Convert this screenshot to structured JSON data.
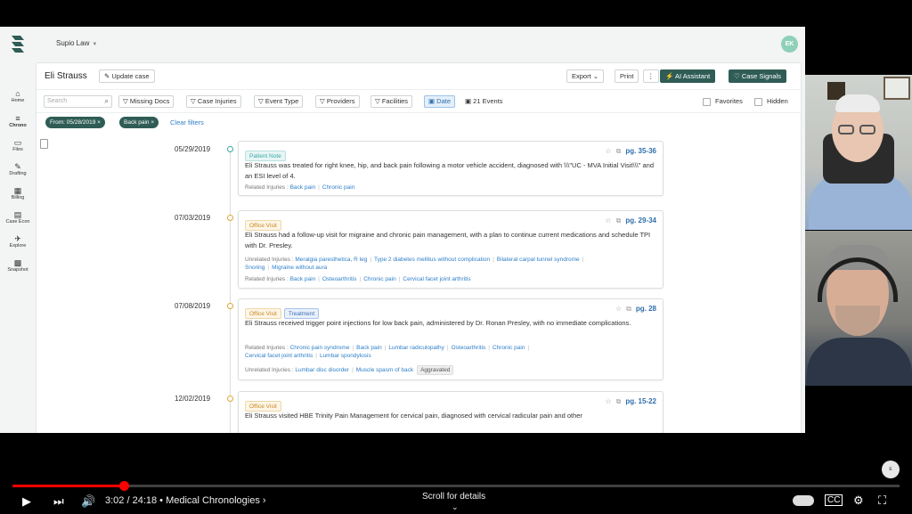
{
  "app": {
    "firm_name": "Supio Law",
    "avatar_initials": "EK",
    "rail": [
      {
        "icon": "home-icon",
        "glyph": "⌂",
        "label": "Home"
      },
      {
        "icon": "chrono-icon",
        "glyph": "≡",
        "label": "Chrono"
      },
      {
        "icon": "files-icon",
        "glyph": "▭",
        "label": "Files"
      },
      {
        "icon": "drafting-icon",
        "glyph": "✎",
        "label": "Drafting"
      },
      {
        "icon": "billing-icon",
        "glyph": "▦",
        "label": "Billing"
      },
      {
        "icon": "case-econ-icon",
        "glyph": "▤",
        "label": "Case Econ"
      },
      {
        "icon": "explore-icon",
        "glyph": "✈",
        "label": "Explore"
      },
      {
        "icon": "snapshot-icon",
        "glyph": "▩",
        "label": "Snapshot"
      }
    ]
  },
  "header": {
    "case_name": "Eli Strauss",
    "update_case": "Update case",
    "export": "Export",
    "print": "Print",
    "more": "⋮",
    "ai_assistant": "AI Assistant",
    "case_signals": "Case Signals"
  },
  "filters": {
    "search_placeholder": "Search",
    "missing_docs": "Missing Docs",
    "case_injuries": "Case Injuries",
    "event_type": "Event Type",
    "providers": "Providers",
    "facilities": "Facilities",
    "date": "Date",
    "events_count": "21 Events",
    "favorites": "Favorites",
    "hidden": "Hidden"
  },
  "chips": {
    "from": "From: 05/28/2019",
    "injury": "Back pain",
    "clear": "Clear filters"
  },
  "events": [
    {
      "date": "05/29/2019",
      "tags": [
        "Patient Note"
      ],
      "pages": "pg. 35-36",
      "description": "Eli Strauss was treated for right knee, hip, and back pain following a motor vehicle accident, diagnosed with \\\\\\\"UC - MVA Initial Visit\\\\\\\" and an ESI level of 4.",
      "related_label": "Related Injuries :",
      "related": [
        "Back pain",
        "Chronic pain"
      ]
    },
    {
      "date": "07/03/2019",
      "tags": [
        "Office Visit"
      ],
      "pages": "pg. 29-34",
      "description": "Eli Strauss had a follow-up visit for migraine and chronic pain management, with a plan to continue current medications and schedule TPI with Dr. Presley.",
      "unrelated_label": "Unrelated Injuries :",
      "unrelated": [
        "Meralgia paresthetica, R leg",
        "Type 2 diabetes mellitus without complication",
        "Bilateral carpal tunnel syndrome",
        "Snoring",
        "Migraine without aura"
      ],
      "related_label": "Related Injuries :",
      "related": [
        "Back pain",
        "Osteoarthritis",
        "Chronic pain",
        "Cervical facet joint arthritis"
      ]
    },
    {
      "date": "07/08/2019",
      "tags": [
        "Office Visit",
        "Treatment"
      ],
      "pages": "pg. 28",
      "description": "Eli Strauss received trigger point injections for low back pain, administered by Dr. Ronan Presley, with no immediate complications.",
      "related_label": "Related Injuries :",
      "related": [
        "Chronic pain syndrome",
        "Back pain",
        "Lumbar radiculopathy",
        "Osteoarthritis",
        "Chronic pain",
        "Cervical facet joint arthritis",
        "Lumbar spondylosis"
      ],
      "unrelated_label": "Unrelated Injuries :",
      "unrelated": [
        "Lumbar disc disorder",
        "Muscle spasm of back"
      ],
      "badge": "Aggravated"
    },
    {
      "date": "12/02/2019",
      "tags": [
        "Office Visit"
      ],
      "pages": "pg. 15-22",
      "description": "Eli Strauss visited HBE Trinity Pain Management for cervical pain, diagnosed with cervical radicular pain and other"
    }
  ],
  "player": {
    "time": "3:02 / 24:18",
    "chapter": "• Medical Chronologies ›",
    "scroll_hint": "Scroll for details",
    "progress": 0.125
  }
}
